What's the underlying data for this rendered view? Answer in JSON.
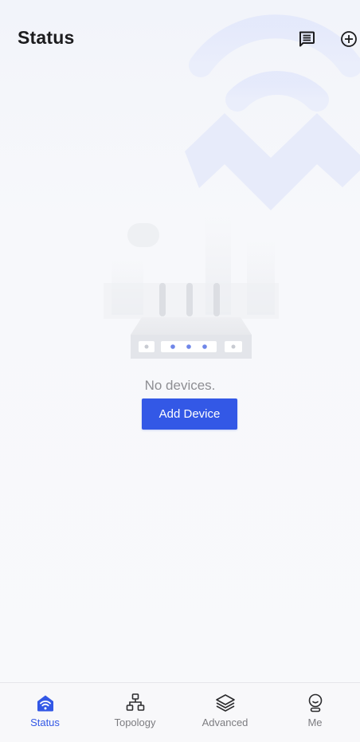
{
  "header": {
    "title": "Status",
    "messages_icon": "message-icon",
    "add_icon": "plus-circle-icon"
  },
  "empty_state": {
    "message": "No devices.",
    "add_button_label": "Add Device"
  },
  "bottom_nav": {
    "items": [
      {
        "label": "Status",
        "icon": "home-wifi-icon",
        "active": true
      },
      {
        "label": "Topology",
        "icon": "topology-icon",
        "active": false
      },
      {
        "label": "Advanced",
        "icon": "layers-icon",
        "active": false
      },
      {
        "label": "Me",
        "icon": "user-icon",
        "active": false
      }
    ]
  },
  "colors": {
    "accent": "#3358e6",
    "title": "#1c1c1e",
    "muted_text": "#8e8e93",
    "nav_inactive": "#7c7c80"
  }
}
